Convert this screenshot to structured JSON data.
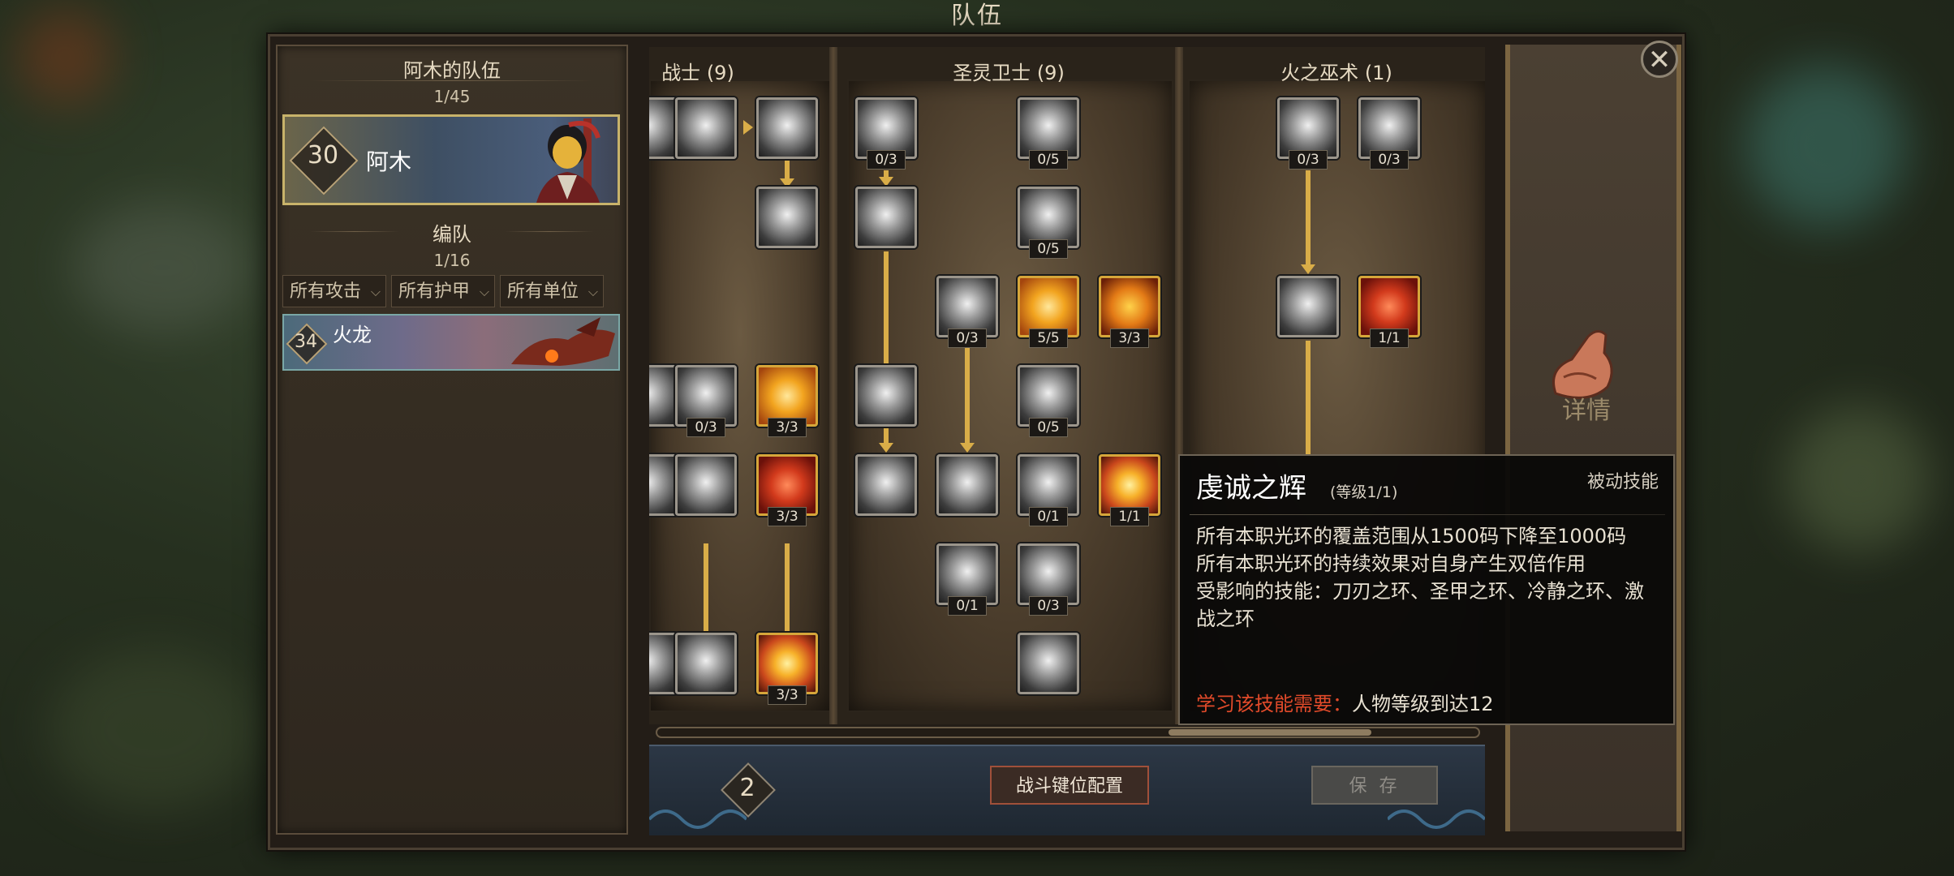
{
  "screen_title": "队伍",
  "team": {
    "title": "阿木的队伍",
    "count": "1/45",
    "hero": {
      "level": "30",
      "name": "阿木"
    }
  },
  "formation": {
    "title": "编队",
    "count": "1/16",
    "filters": [
      "所有攻击",
      "所有护甲",
      "所有单位"
    ],
    "unit": {
      "level": "34",
      "name": "火龙"
    }
  },
  "columns": [
    {
      "name": "战士 (9)"
    },
    {
      "name": "圣灵卫士 (9)"
    },
    {
      "name": "火之巫术 (1)"
    }
  ],
  "skill_badges": {
    "w1": "0/3",
    "w2": "3/3",
    "w3": "3/3",
    "w4": "3/3",
    "p1": "0/3",
    "p2": "0/5",
    "p3": "0/5",
    "p4": "0/3",
    "p5": "5/5",
    "p6": "3/3",
    "p7": "0/5",
    "p8": "0/1",
    "p9": "1/1",
    "p10": "0/1",
    "p11": "0/3",
    "f1": "0/3",
    "f2": "0/3",
    "f3": "1/1"
  },
  "bottom": {
    "points": "2",
    "keybind_button": "战斗键位配置",
    "save_button": "保 存"
  },
  "right_panel": {
    "details_label": "详情"
  },
  "tooltip": {
    "title": "虔诚之辉",
    "level": "(等级1/1)",
    "type": "被动技能",
    "line1": "所有本职光环的覆盖范围从1500码下降至1000码",
    "line2": "所有本职光环的持续效果对自身产生双倍作用",
    "line3": "受影响的技能：刀刃之环、圣甲之环、冷静之环、激战之环",
    "req_label": "学习该技能需要：",
    "req_value": "人物等级到达12"
  },
  "colors": {
    "accent_gold": "#d9ad48",
    "requirement_red": "#e04a2a"
  }
}
